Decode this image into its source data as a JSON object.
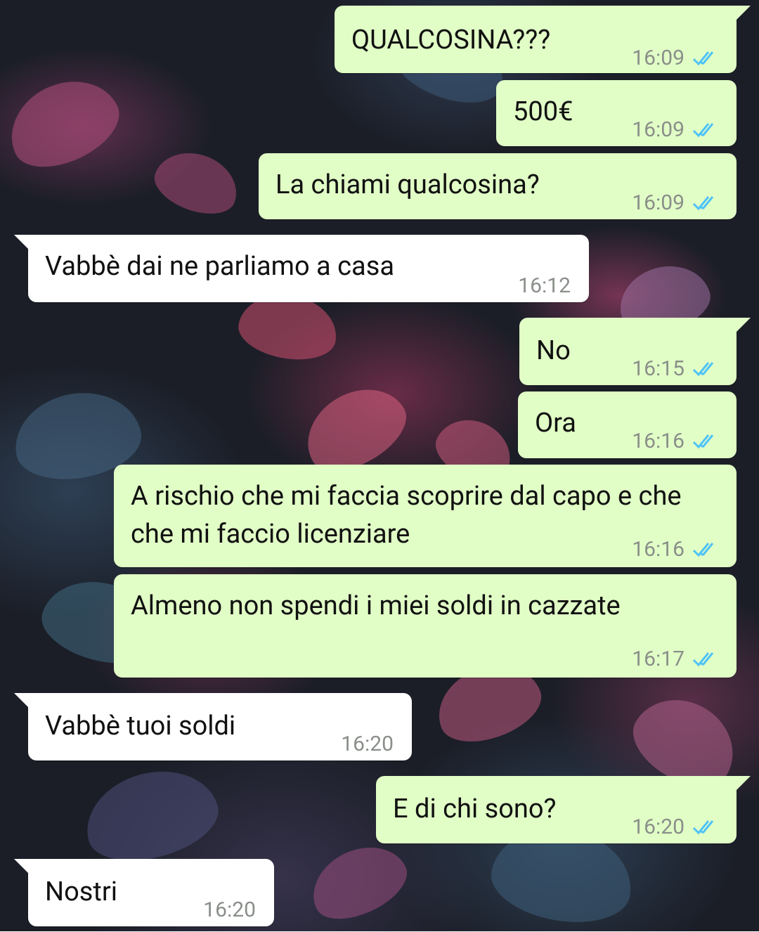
{
  "colors": {
    "outgoing_bubble": "#e1fec6",
    "incoming_bubble": "#ffffff",
    "timestamp": "#8a8f8a",
    "read_ticks": "#4fc3f7"
  },
  "messages": [
    {
      "direction": "out",
      "text": "QUALCOSINA???",
      "time": "16:09",
      "status_icon": "double-check-read-icon"
    },
    {
      "direction": "out",
      "text": "500€",
      "time": "16:09",
      "status_icon": "double-check-read-icon"
    },
    {
      "direction": "out",
      "text": "La chiami qualcosina?",
      "time": "16:09",
      "status_icon": "double-check-read-icon"
    },
    {
      "direction": "in",
      "text": "Vabbè dai ne parliamo a casa",
      "time": "16:12"
    },
    {
      "direction": "out",
      "text": "No",
      "time": "16:15",
      "status_icon": "double-check-read-icon"
    },
    {
      "direction": "out",
      "text": "Ora",
      "time": "16:16",
      "status_icon": "double-check-read-icon"
    },
    {
      "direction": "out",
      "text": "A rischio che mi faccia scoprire dal capo e che che mi faccio licenziare",
      "time": "16:16",
      "status_icon": "double-check-read-icon"
    },
    {
      "direction": "out",
      "text": "Almeno non spendi i miei soldi in cazzate",
      "time": "16:17",
      "status_icon": "double-check-read-icon"
    },
    {
      "direction": "in",
      "text": "Vabbè tuoi soldi",
      "time": "16:20"
    },
    {
      "direction": "out",
      "text": "E di chi sono?",
      "time": "16:20",
      "status_icon": "double-check-read-icon"
    },
    {
      "direction": "in",
      "text": "Nostri",
      "time": "16:20"
    }
  ]
}
